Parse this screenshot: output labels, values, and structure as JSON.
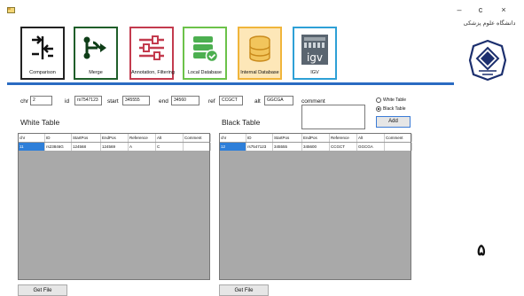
{
  "window": {
    "minimize": "–",
    "maximize": "c",
    "close": "×"
  },
  "toolbar": [
    {
      "label": "Comparison",
      "icon": "comparison-icon",
      "border": "#222222"
    },
    {
      "label": "Merge",
      "icon": "merge-icon",
      "border": "#1f5e2a"
    },
    {
      "label": "Annotation, Filtering",
      "icon": "sliders-icon",
      "border": "#c33b4e"
    },
    {
      "label": "Local Database",
      "icon": "local-database-icon",
      "border": "#6cc24a"
    },
    {
      "label": "Internal Database",
      "icon": "internal-database-icon",
      "border": "#f0b53b"
    },
    {
      "label": "IGV",
      "icon": "igv-icon",
      "border": "#2ea0d6"
    }
  ],
  "logo": {
    "script_text": "دانشگاه علوم پزشکی"
  },
  "fields": {
    "chr": {
      "label": "chr",
      "value": "2"
    },
    "id": {
      "label": "id",
      "value": "rs7547123"
    },
    "start": {
      "label": "start",
      "value": "345555"
    },
    "end": {
      "label": "end",
      "value": "34560"
    },
    "ref": {
      "label": "ref",
      "value": "CCGCT"
    },
    "alt": {
      "label": "alt",
      "value": "GGCGA"
    },
    "comment": {
      "label": "comment",
      "value": ""
    }
  },
  "radios": {
    "white": "White Table",
    "black": "Black Table",
    "selected": "black"
  },
  "add_button": "Add",
  "white_table": {
    "title": "White Table",
    "columns": [
      "chr",
      "ID",
      "StartPos",
      "EndPos",
      "Reference",
      "Alt",
      "Comment"
    ],
    "rows": [
      [
        "11",
        "rs23846G",
        "124568",
        "124569",
        "A",
        "C",
        ""
      ]
    ]
  },
  "black_table": {
    "title": "Black Table",
    "columns": [
      "chr",
      "ID",
      "StartPos",
      "EndPos",
      "Reference",
      "Alt",
      "Comment"
    ],
    "rows": [
      [
        "12",
        "rs7547123",
        "345555",
        "345600",
        "CCGCT",
        "GGCGA",
        ""
      ]
    ]
  },
  "get_file_label": "Get File",
  "page_number": "۵",
  "colors": {
    "accent": "#2a6bc2",
    "selection": "#2e7fd9",
    "grid_bg": "#a9a9a9"
  }
}
